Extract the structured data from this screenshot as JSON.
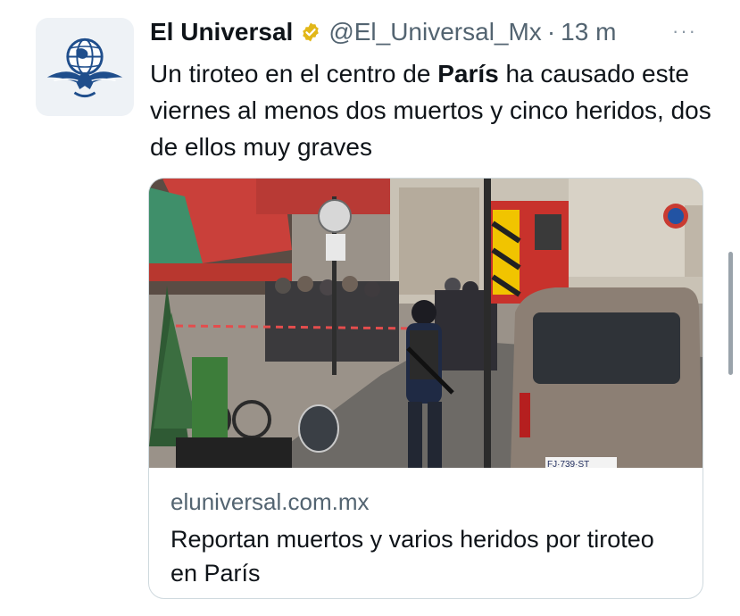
{
  "author": {
    "display_name": "El Universal",
    "handle": "@El_Universal_Mx",
    "separator": "·",
    "timestamp": "13 m",
    "verified_icon": "verified-badge-icon",
    "avatar_icon": "el-universal-globe-eagle-logo"
  },
  "tweet": {
    "text_part1": "Un tiroteo en el centro de ",
    "text_bold": "París",
    "text_part2": " ha causado este viernes al menos dos muertos y cinco heridos, dos de ellos muy graves"
  },
  "card": {
    "domain": "eluniversal.com.mx",
    "title": "Reportan muertos y varios heridos por tiroteo en París",
    "image_icon": "news-photo-paris-street-police",
    "plate": "FJ·739·ST"
  },
  "menu": {
    "more_label": "···"
  },
  "colors": {
    "text": "#0f1419",
    "secondary": "#536471",
    "border": "#cfd9de",
    "verified_gold": "#e2b719"
  }
}
